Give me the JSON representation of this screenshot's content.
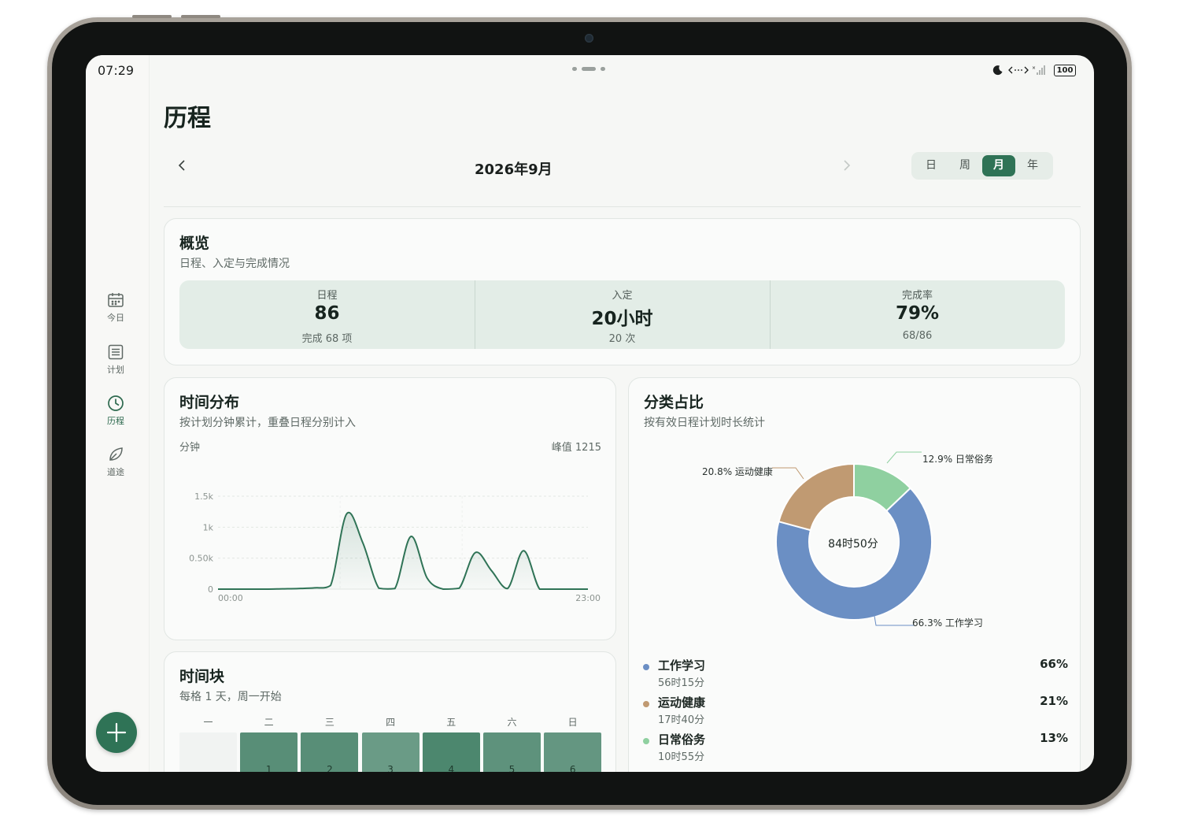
{
  "status_bar": {
    "time": "07:29",
    "battery": "100"
  },
  "sidebar": {
    "items": [
      {
        "label": "今日",
        "icon": "calendar-icon"
      },
      {
        "label": "计划",
        "icon": "list-icon"
      },
      {
        "label": "历程",
        "icon": "clock-icon",
        "active": true
      },
      {
        "label": "道途",
        "icon": "leaf-icon"
      }
    ],
    "fab_icon": "plus-icon"
  },
  "page": {
    "title": "历程"
  },
  "period": {
    "label": "2026年9月",
    "tabs": [
      {
        "label": "日"
      },
      {
        "label": "周"
      },
      {
        "label": "月",
        "active": true
      },
      {
        "label": "年"
      }
    ]
  },
  "overview": {
    "title": "概览",
    "subtitle": "日程、入定与完成情况",
    "stats": [
      {
        "label": "日程",
        "value": "86",
        "sub": "完成 68 项"
      },
      {
        "label": "入定",
        "value": "20小时",
        "sub": "20 次"
      },
      {
        "label": "完成率",
        "value": "79%",
        "sub": "68/86"
      }
    ]
  },
  "time_dist": {
    "title": "时间分布",
    "subtitle": "按计划分钟累计，重叠日程分别计入",
    "unit": "分钟",
    "peak": "峰值 1215"
  },
  "time_blocks": {
    "title": "时间块",
    "subtitle": "每格 1 天，周一开始",
    "weekdays": [
      "一",
      "二",
      "三",
      "四",
      "五",
      "六",
      "日"
    ],
    "cells": [
      {
        "day": "",
        "level": 0
      },
      {
        "day": "1",
        "level": 0.75
      },
      {
        "day": "2",
        "level": 0.75
      },
      {
        "day": "3",
        "level": 0.6
      },
      {
        "day": "4",
        "level": 0.85
      },
      {
        "day": "5",
        "level": 0.7
      },
      {
        "day": "6",
        "level": 0.65
      }
    ]
  },
  "category": {
    "title": "分类占比",
    "subtitle": "按有效日程计划时长统计",
    "center_label": "84时50分",
    "legend": [
      {
        "name": "工作学习",
        "time": "56时15分",
        "pct": "66%",
        "color": "#6b8fc4"
      },
      {
        "name": "运动健康",
        "time": "17时40分",
        "pct": "21%",
        "color": "#c09a72"
      },
      {
        "name": "日常俗务",
        "time": "10时55分",
        "pct": "13%",
        "color": "#8fd0a0"
      }
    ],
    "donut_labels": [
      {
        "text": "12.9% 日常俗务"
      },
      {
        "text": "20.8% 运动健康"
      },
      {
        "text": "66.3% 工作学习"
      }
    ]
  },
  "chart_data": {
    "type": "area",
    "ylabel": "分钟",
    "x_tick_labels": [
      "00:00",
      "23:00"
    ],
    "y_tick_labels": [
      "0",
      "0.50k",
      "1k",
      "1.5k"
    ],
    "ylim": [
      0,
      1500
    ],
    "x": [
      "00:00",
      "01:00",
      "02:00",
      "03:00",
      "04:00",
      "05:00",
      "06:00",
      "07:00",
      "08:00",
      "09:00",
      "10:00",
      "11:00",
      "12:00",
      "13:00",
      "14:00",
      "15:00",
      "16:00",
      "17:00",
      "18:00",
      "19:00",
      "20:00",
      "21:00",
      "22:00",
      "23:00"
    ],
    "series": [
      {
        "values": [
          0,
          0,
          0,
          0,
          5,
          10,
          20,
          60,
          1215,
          750,
          15,
          10,
          850,
          180,
          0,
          15,
          590,
          300,
          10,
          620,
          0,
          0,
          0,
          0
        ]
      }
    ],
    "peak": 1215,
    "grid": true
  },
  "pie_data": {
    "type": "pie",
    "categories": [
      "日常俗务",
      "工作学习",
      "运动健康"
    ],
    "values": [
      12.9,
      66.3,
      20.8
    ],
    "colors": [
      "#8fd0a0",
      "#6b8fc4",
      "#c09a72"
    ]
  }
}
